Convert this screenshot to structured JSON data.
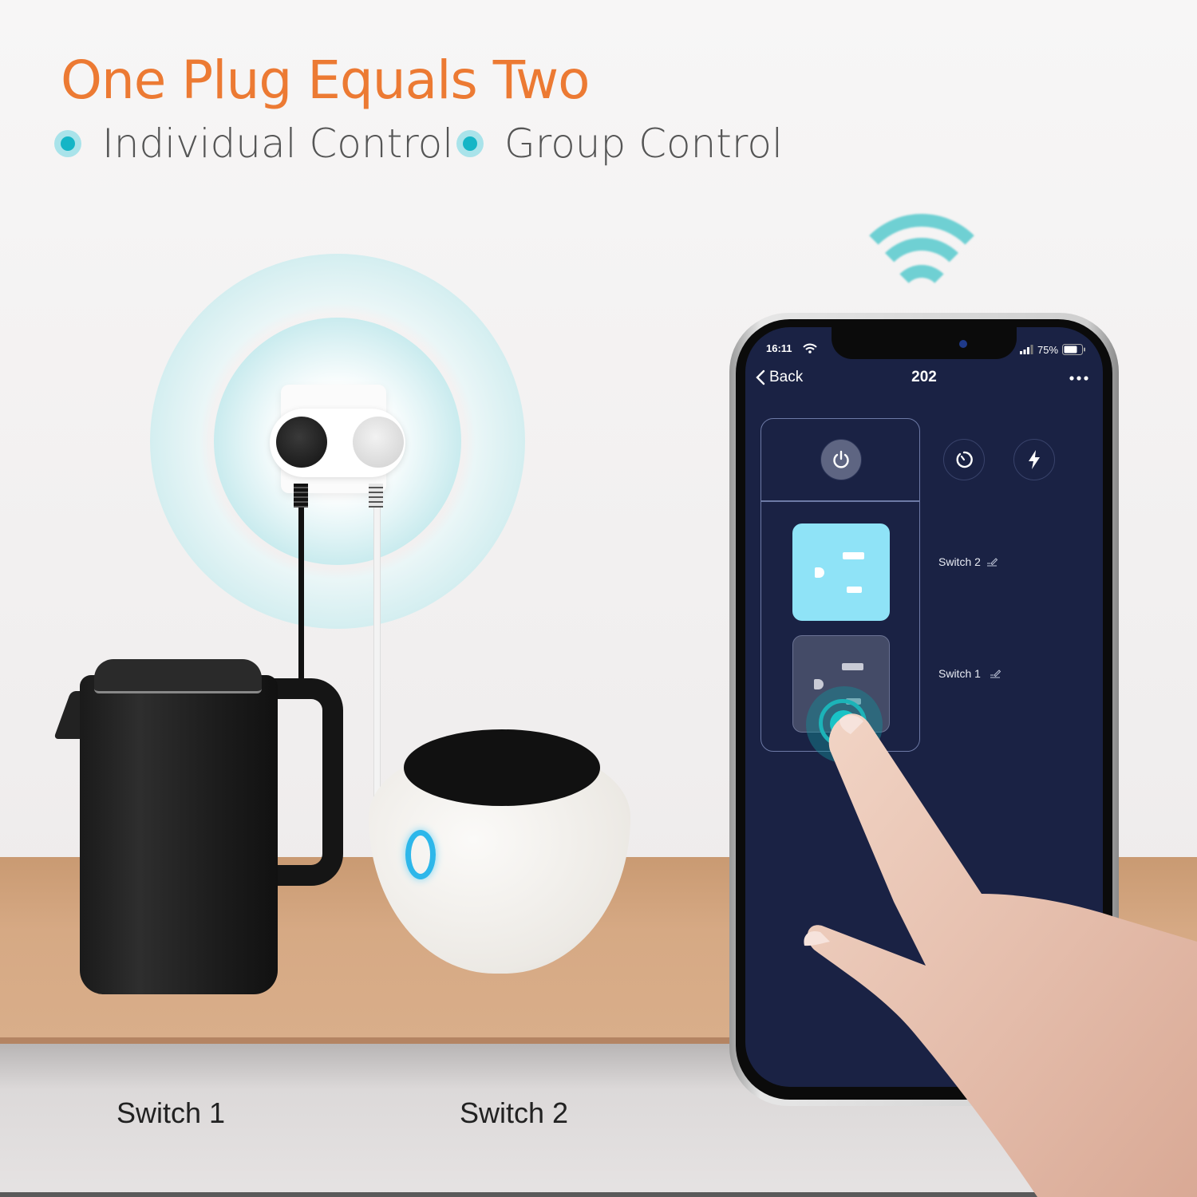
{
  "header": {
    "title": "One Plug Equals Two",
    "features": [
      {
        "label": "Individual Control",
        "icon": "bullet-dot-icon"
      },
      {
        "label": "Group Control",
        "icon": "bullet-dot-icon"
      }
    ]
  },
  "scene": {
    "labels": [
      "Switch 1",
      "Switch 2"
    ],
    "devices": [
      "kettle",
      "rice-cooker"
    ]
  },
  "colors": {
    "headline": "#ec7a33",
    "accent": "#14b5c6",
    "app_background": "#1a2244",
    "outlet_on": "#8fe3f7"
  },
  "phone": {
    "status_bar": {
      "time": "16:11",
      "battery": "75%"
    },
    "nav": {
      "back_label": "Back",
      "title": "202",
      "more_icon": "more-horizontal-icon"
    },
    "controls": [
      {
        "name": "power",
        "icon": "power-icon"
      },
      {
        "name": "timer",
        "icon": "timer-icon"
      },
      {
        "name": "energy",
        "icon": "lightning-icon"
      }
    ],
    "switches": [
      {
        "label": "Switch 2",
        "state": "on",
        "edit_icon": "edit-icon"
      },
      {
        "label": "Switch 1",
        "state": "off",
        "edit_icon": "edit-icon"
      }
    ]
  }
}
